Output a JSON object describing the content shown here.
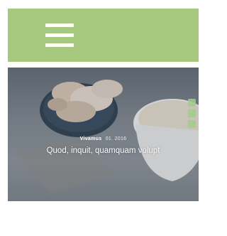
{
  "navbar": {
    "background_color": "#a7c97f",
    "menu_icon": "hamburger-menu-icon"
  },
  "hero": {
    "author": "Vivamus",
    "date": "01. 2016",
    "title": "Quod, inquit, quamquam volupt",
    "social_icons": [
      "social-icon",
      "social-icon",
      "social-icon"
    ],
    "social_color": "#9fcf8a"
  }
}
